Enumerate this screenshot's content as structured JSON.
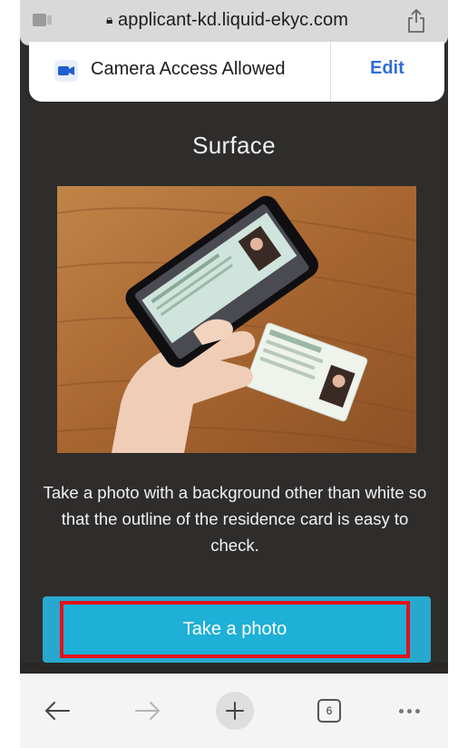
{
  "browser": {
    "url": "applicant-kd.liquid-ekyc.com",
    "tab_count": "6"
  },
  "permission_banner": {
    "label": "Camera Access Allowed",
    "edit_label": "Edit"
  },
  "main": {
    "title": "Surface",
    "description": "Take a photo with a background other than white so that the outline of the residence card is easy to check.",
    "button_label": "Take a photo"
  },
  "colors": {
    "page_bg": "#2f2d2c",
    "button": "#1eb0d6",
    "highlight_border": "#e3121a",
    "edit_link": "#2f6fd6"
  },
  "icons": {
    "tabs": "tabs-icon",
    "lock": "lock-icon",
    "share": "share-icon",
    "camera": "video-camera-icon",
    "back": "back-arrow-icon",
    "forward": "forward-arrow-icon",
    "new_tab": "plus-icon",
    "more": "more-dots-icon"
  }
}
